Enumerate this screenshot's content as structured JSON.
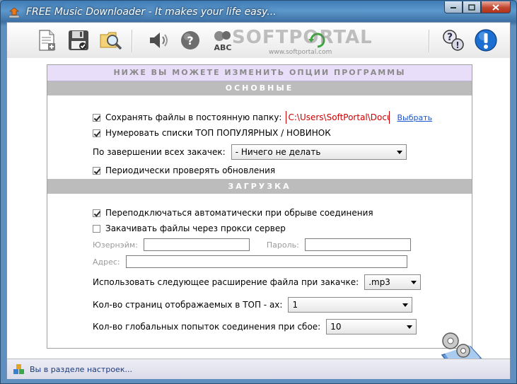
{
  "window": {
    "title": "FREE Music Downloader - It makes your life easy..."
  },
  "watermark": {
    "main": "SOFTPORTAL",
    "sub": "www.softportal.com"
  },
  "toolbar": {
    "buttons": [
      {
        "icon": "new-document-icon"
      },
      {
        "icon": "save-floppy-icon"
      },
      {
        "icon": "find-folder-icon"
      },
      {
        "icon": "speaker-icon"
      },
      {
        "icon": "help-sphere-icon"
      },
      {
        "icon": "abc-spellcheck-icon"
      },
      {
        "icon": "question-help-icon"
      },
      {
        "icon": "info-exclamation-icon"
      }
    ]
  },
  "options": {
    "banner": "НИЖЕ ВЫ МОЖЕТЕ ИЗМЕНИТЬ ОПЦИИ ПРОГРАММЫ",
    "section_main": "ОСНОВНЫЕ",
    "save_folder_label": "Сохранять файлы в постоянную папку:",
    "save_folder_checked": true,
    "save_folder_path": "C:\\Users\\SoftPortal\\Docum",
    "browse_label": "Выбрать",
    "numbering_label": "Нумеровать списки ТОП ПОПУЛЯРНЫХ / НОВИНОК",
    "numbering_checked": true,
    "on_complete_label": "По завершении всех закачек:",
    "on_complete_value": "- Ничего не делать",
    "check_updates_label": "Периодически проверять обновления",
    "check_updates_checked": true,
    "section_download": "ЗАГРУЗКА",
    "reconnect_label": "Переподключаться автоматически при обрыве соединения",
    "reconnect_checked": true,
    "proxy_label": "Закачивать файлы через прокси сервер",
    "proxy_checked": false,
    "username_label": "Юзернэйм:",
    "username_value": "",
    "password_label": "Пароль:",
    "password_value": "",
    "address_label": "Адрес:",
    "address_value": "",
    "extension_label": "Использовать следующее расширение файла при закачке:",
    "extension_value": ".mp3",
    "pages_label": "Кол-во страниц отображаемых в ТОП - ах:",
    "pages_value": "1",
    "retries_label": "Кол-во глобальных попыток соединения при сбое:",
    "retries_value": "10"
  },
  "status": {
    "text": "Вы в разделе настроек..."
  }
}
